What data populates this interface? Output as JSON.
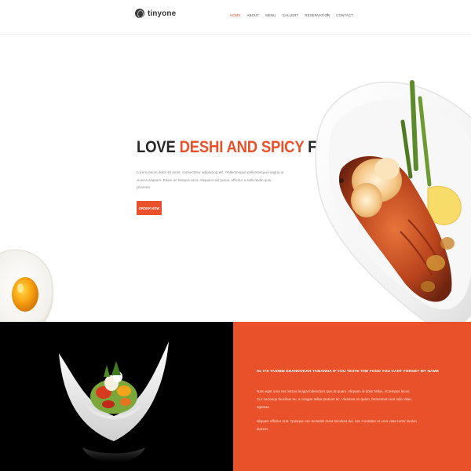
{
  "header": {
    "logo_text": "tinyone",
    "nav": [
      "HOME",
      "ABOUT",
      "MENU",
      "GALLERY",
      "RESERVATION",
      "CONTACT"
    ],
    "active_index": 0,
    "search_glyph": "⌕"
  },
  "hero": {
    "title_part1": "LOVE ",
    "title_accent": "DESHI AND SPICY",
    "title_part2": " FOOD",
    "text": "Lorem ipsum dolor sit amet, consectetur adipiscing elit. Pellentesque pellentesque magna ut viverra aliquam. Etiam ac tempus arcu. Aliquam nisl purus, efficitur a sollicitudin quis, pharetra",
    "button_label": "ORDER NOW"
  },
  "about": {
    "title": "HI, ITS TASNIM KHANDOKAR TAMANNA IF YOU TESTE THE FOOD YOU CANT FORGET MY NAME",
    "paragraph1": "Nam eget urna nec lectus feugiat bibendum quis at quam. Aliquam id dolor tellus, et tempus lacus. Cur sociosqu faucibus eu, a congue tellus pretium ac. Vivamus mi quam, fermentum sed odio vitae, egestas",
    "paragraph2": "aliquam efficitur erat. Quisque nec molestie mest tincidunt dui. nec Curabitur et urna vitae tortor lacinia laoreet."
  },
  "colors": {
    "accent": "#e9512a",
    "dark": "#262626",
    "black": "#000000"
  },
  "icons": {
    "logo": "logo-mark-icon",
    "search": "search-icon"
  }
}
